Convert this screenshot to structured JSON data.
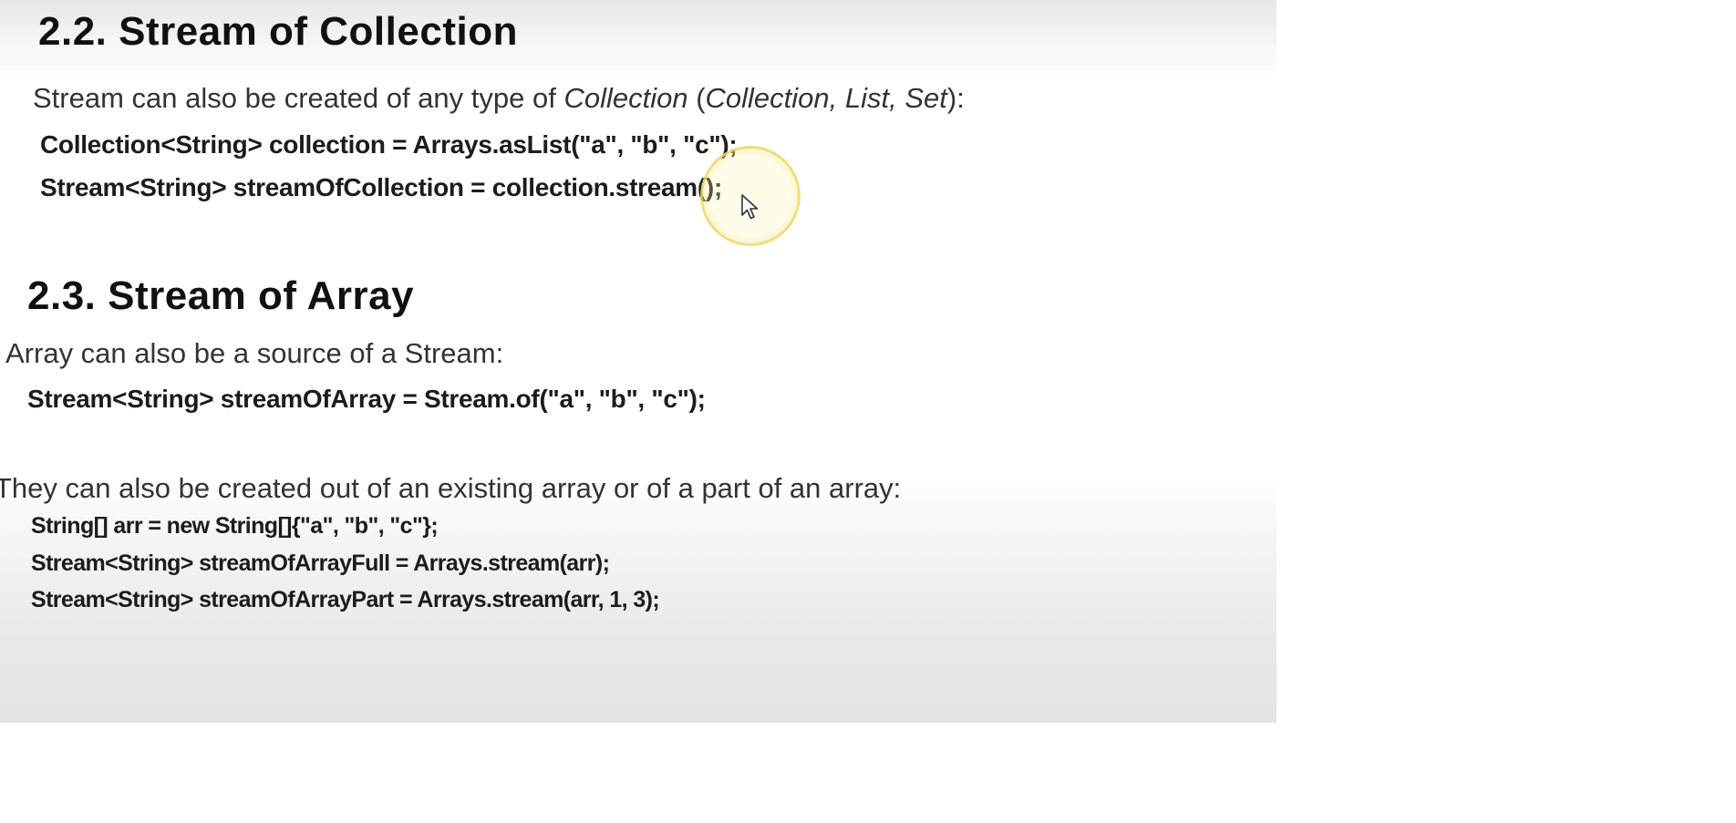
{
  "sections": [
    {
      "heading": "2.2. Stream of Collection",
      "intro": {
        "lead": "Stream can also be created of any type of ",
        "em1": "Collection",
        "mid": " (",
        "em2": "Collection, List, Set",
        "tail": "):"
      },
      "code": [
        "Collection<String> collection = Arrays.asList(\"a\", \"b\", \"c\");",
        "Stream<String> streamOfCollection = collection.stream();"
      ]
    },
    {
      "heading": "2.3. Stream of Array",
      "intro": "Array can also be a source of a Stream:",
      "code": [
        "Stream<String> streamOfArray = Stream.of(\"a\", \"b\", \"c\");"
      ],
      "intro2": "They can also be created out of an existing array or of a part of an array:",
      "code2": [
        "String[] arr = new String[]{\"a\", \"b\", \"c\"};",
        "Stream<String> streamOfArrayFull = Arrays.stream(arr);",
        "Stream<String> streamOfArrayPart = Arrays.stream(arr, 1, 3);"
      ]
    }
  ],
  "colors": {
    "cursor_highlight": "#ecd66e",
    "text": "#1c1c1c"
  },
  "icons": {
    "cursor": "mouse-pointer-icon"
  }
}
